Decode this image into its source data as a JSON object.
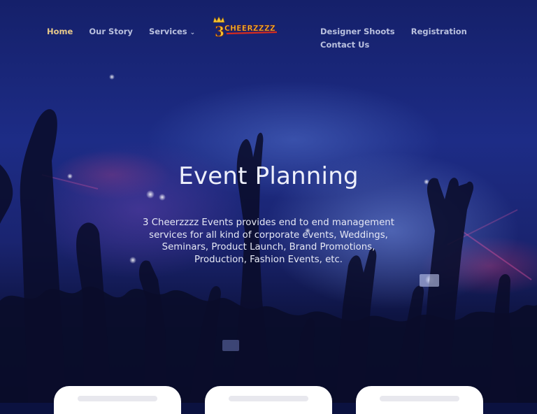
{
  "nav": {
    "left": [
      {
        "label": "Home",
        "active": true
      },
      {
        "label": "Our Story"
      },
      {
        "label": "Services"
      }
    ],
    "right": [
      {
        "label": "Designer Shoots"
      },
      {
        "label": "Registration"
      },
      {
        "label": "Contact Us"
      }
    ],
    "services_caret": "⌄"
  },
  "logo": {
    "prefix": "3",
    "name": "CHEERZZZZ",
    "crown_icon": "crown-icon"
  },
  "hero": {
    "title": "Event Planning",
    "description": "3 Cheerzzzz Events provides end to end management services for all kind of corporate events, Weddings, Seminars, Product Launch, Brand Promotions, Production, Fashion Events, etc."
  },
  "slider": {
    "count": 4,
    "active": 1
  },
  "colors": {
    "accent": "#e7c98a",
    "nav_text": "#b9c0de",
    "logo_red": "#d62a1e",
    "logo_gold": "#f2c230"
  }
}
